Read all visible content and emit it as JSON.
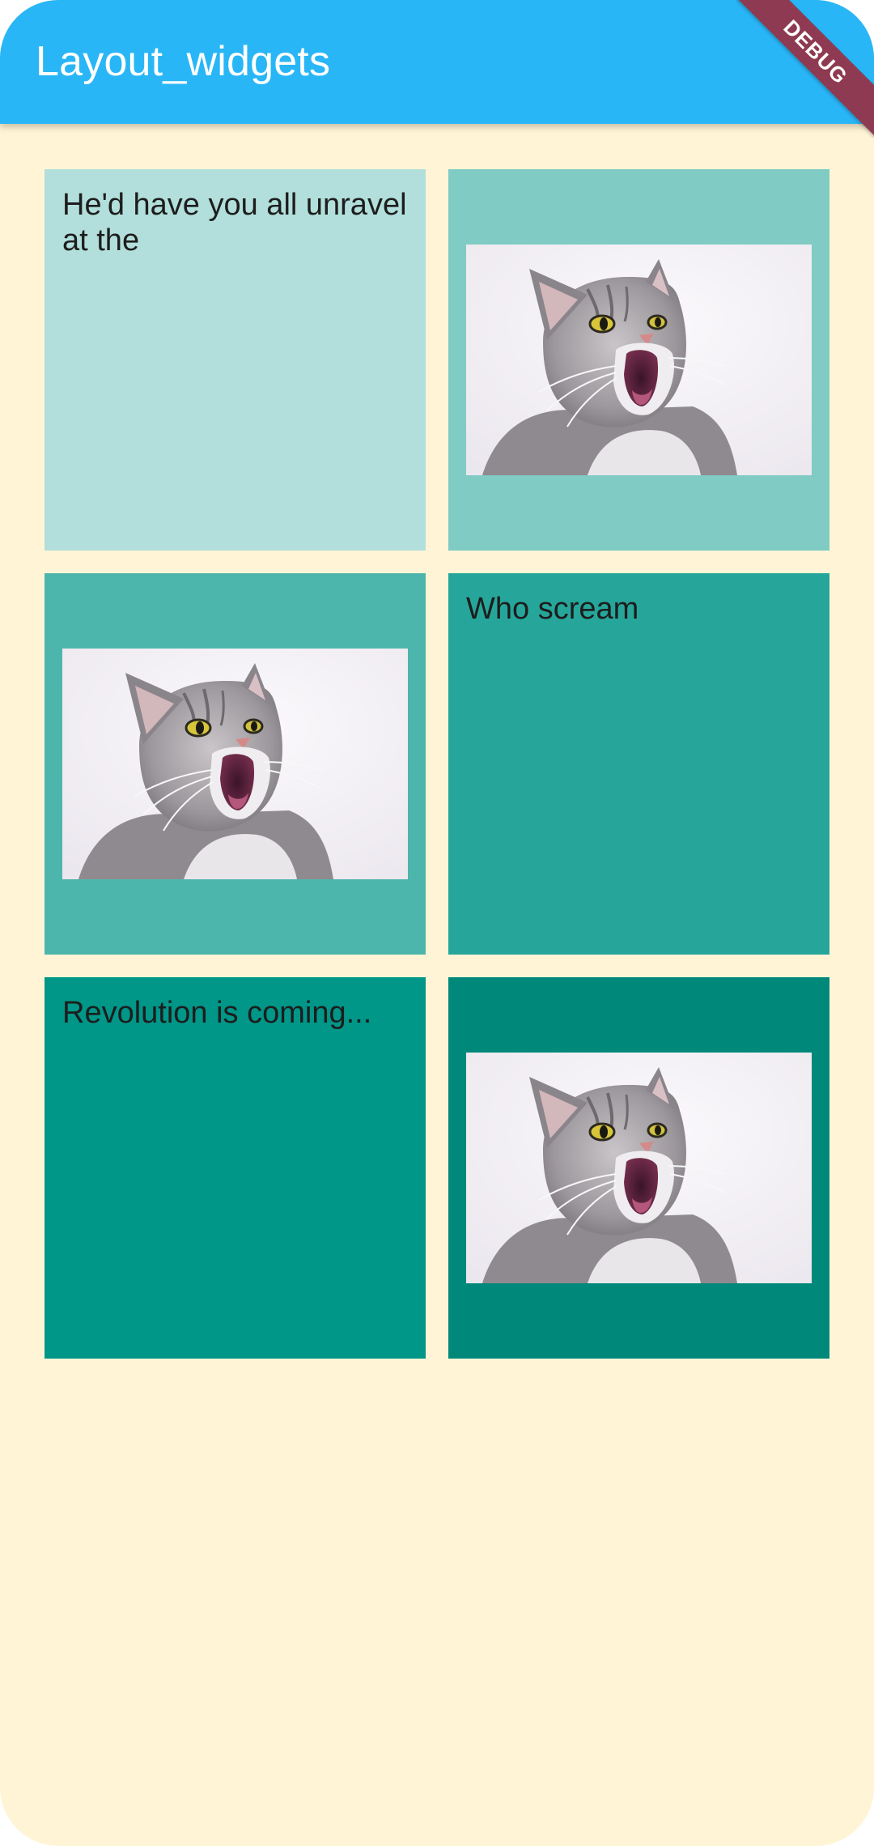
{
  "appbar": {
    "title": "Layout_widgets",
    "color": "#29b6f6",
    "debug_banner": "DEBUG"
  },
  "background": "#fff5d6",
  "tiles": [
    {
      "kind": "text",
      "text": "He'd have you all unravel at the",
      "color": "#b2dfdb"
    },
    {
      "kind": "image",
      "image": "screaming-cat-photo",
      "color": "#80cbc4"
    },
    {
      "kind": "image",
      "image": "screaming-cat-photo",
      "color": "#4db6ac"
    },
    {
      "kind": "text",
      "text": "Who scream",
      "color": "#26a69a"
    },
    {
      "kind": "text",
      "text": "Revolution is coming...",
      "color": "#009688"
    },
    {
      "kind": "image",
      "image": "screaming-cat-photo",
      "color": "#00897b"
    }
  ]
}
